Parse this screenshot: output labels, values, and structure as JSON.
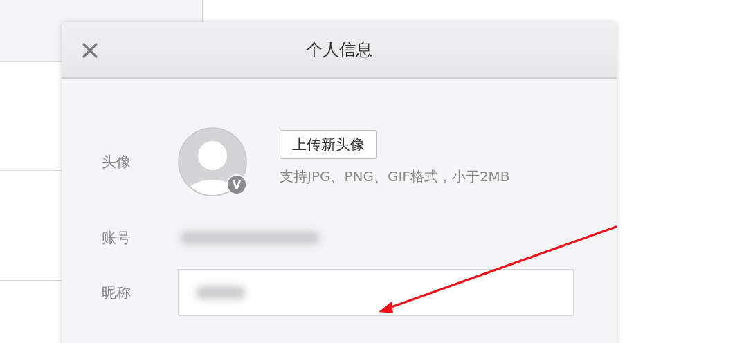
{
  "dialog": {
    "title": "个人信息",
    "avatar": {
      "label": "头像",
      "badge": "V",
      "upload_button": "上传新头像",
      "hint": "支持JPG、PNG、GIF格式，小于2MB"
    },
    "account": {
      "label": "账号"
    },
    "nickname": {
      "label": "昵称"
    }
  }
}
